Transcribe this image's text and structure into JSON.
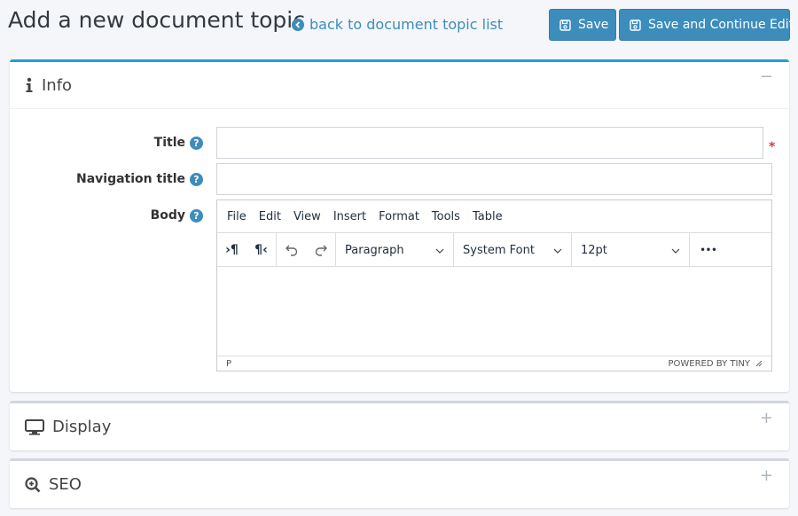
{
  "header": {
    "title": "Add a new document topic",
    "back_link": "back to document topic list",
    "save_label": "Save",
    "save_continue_label": "Save and Continue Edit"
  },
  "colors": {
    "accent": "#3c8dbc",
    "card_accent": "#17a2d8",
    "required": "#dc3545"
  },
  "info": {
    "title": "Info",
    "collapse_symbol": "−",
    "fields": {
      "title_label": "Title",
      "title_value": "",
      "nav_label": "Navigation title",
      "nav_value": "",
      "body_label": "Body",
      "help_symbol": "?",
      "required_marker": "*"
    },
    "editor": {
      "menu": [
        "File",
        "Edit",
        "View",
        "Insert",
        "Format",
        "Tools",
        "Table"
      ],
      "ltr_symbol": "›¶",
      "rtl_symbol": "¶‹",
      "block_format": "Paragraph",
      "font_family": "System Font",
      "font_size": "12pt",
      "more_symbol": "•••",
      "status_path": "P",
      "branding": "POWERED BY TINY"
    }
  },
  "display": {
    "title": "Display",
    "expand_symbol": "+"
  },
  "seo": {
    "title": "SEO",
    "expand_symbol": "+"
  }
}
